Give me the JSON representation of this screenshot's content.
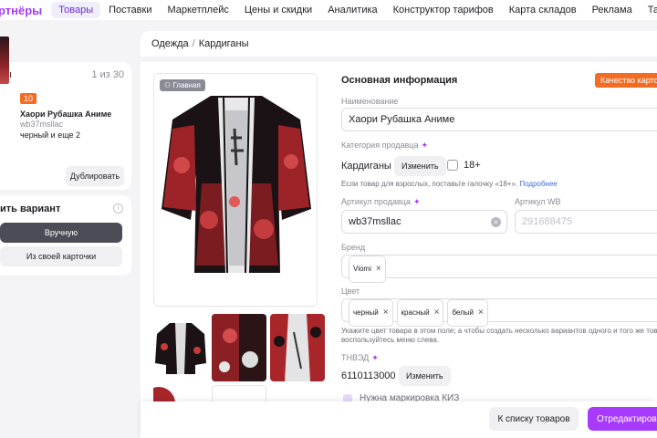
{
  "nav": {
    "brand": "ртнёры",
    "items": [
      "Товары",
      "Поставки",
      "Маркетплейс",
      "Цены и скидки",
      "Аналитика",
      "Конструктор тарифов",
      "Карта складов",
      "Реклама",
      "Тарифы"
    ],
    "active": "Товары"
  },
  "left": {
    "header_label": "ты",
    "counter": "1 из 30",
    "product": {
      "badge": "10",
      "name": "Хаори Рубашка Аниме",
      "vendor_code": "wb37msllac",
      "colors": "черный и еще 2"
    },
    "duplicate_label": "Дублировать",
    "variant_title": "ить вариант",
    "manual_label": "Вручную",
    "from_card_label": "Из своей карточки"
  },
  "breadcrumb": [
    "Одежда",
    "Кардиганы"
  ],
  "photo": {
    "main_tag": "Главная"
  },
  "form": {
    "section_title": "Основная информация",
    "quality_label": "Качество карточки",
    "name_label": "Наименование",
    "name_value": "Хаори Рубашка Аниме",
    "category_label": "Категория продавца",
    "category_value": "Кардиганы",
    "change_label": "Изменить",
    "adult_label": "18+",
    "adult_hint": "Если товар для взрослых, поставьте галочку «18+».",
    "adult_hint_link": "Подробнее",
    "seller_article_label": "Артикул продавца",
    "seller_article_value": "wb37msllac",
    "wb_article_label": "Артикул WB",
    "wb_article_value": "291688475",
    "brand_label": "Бренд",
    "brand_value": "Viomi",
    "color_label": "Цвет",
    "colors": [
      "черный",
      "красный",
      "белый"
    ],
    "color_hint_1": "Укажите цвет товара в этом поле; а чтобы создать несколько вариантов одного и того же това",
    "color_hint_2": "воспользуйтесь меню слева.",
    "tnved_label": "ТНВЭД",
    "tnved_value": "6110113000",
    "tnved_change_label": "Изменить",
    "marking_label": "Нужна маркировка КИЗ"
  },
  "footer": {
    "back_label": "К списку товаров",
    "edit_label": "Отредактировать"
  },
  "colors": {
    "accent": "#a73afd",
    "orange": "#f36c21"
  }
}
